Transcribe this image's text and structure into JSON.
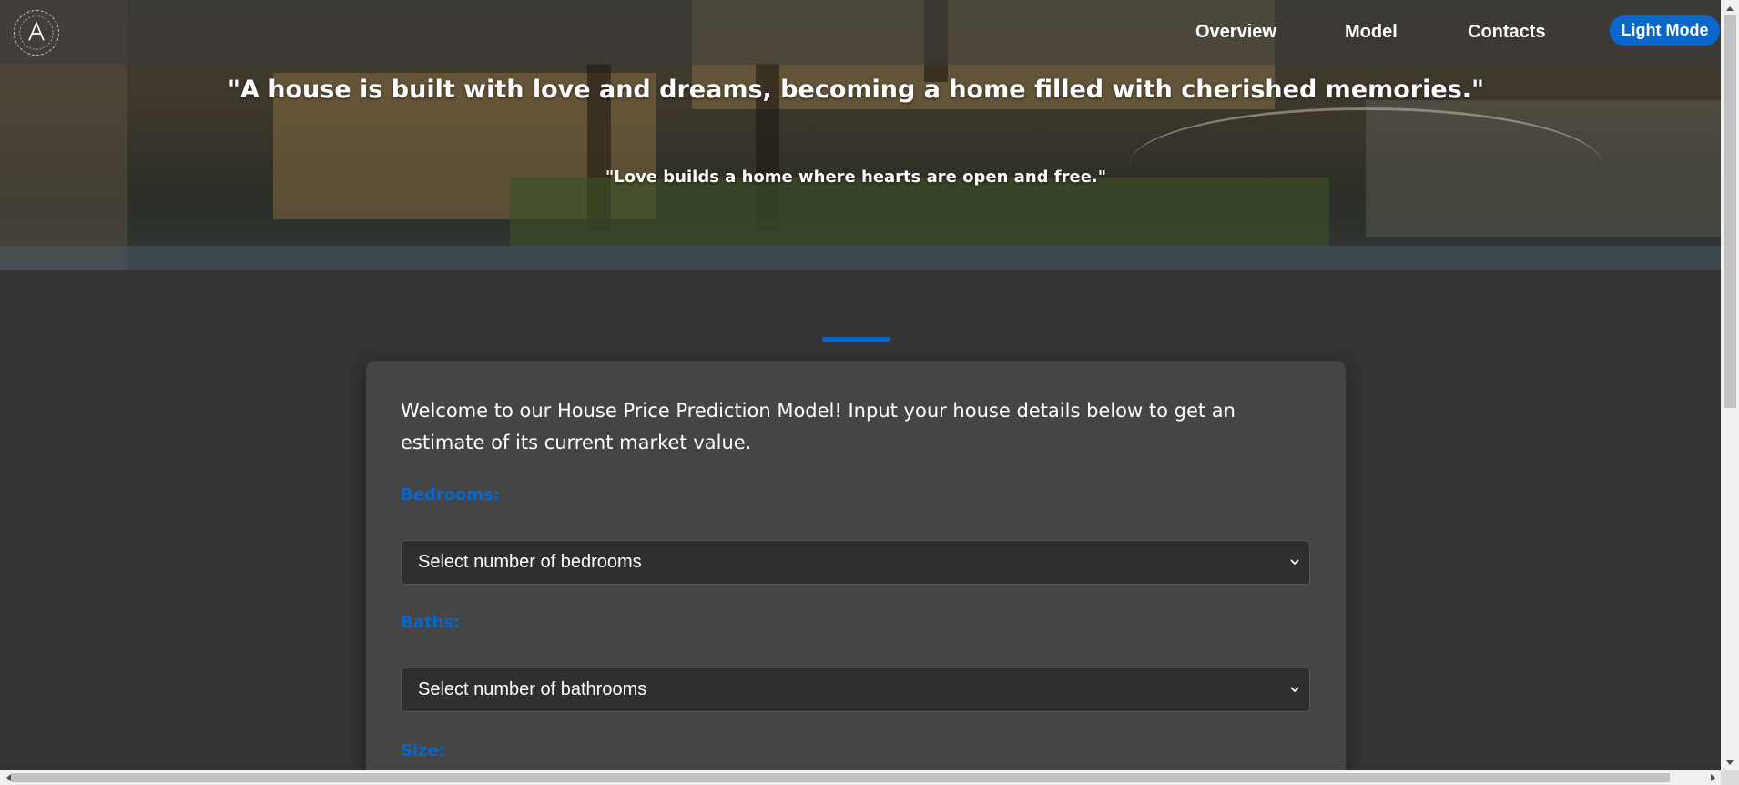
{
  "navbar": {
    "logo_icon": "circular-logo-letter-a-icon",
    "links": [
      {
        "label": "Overview"
      },
      {
        "label": "Model"
      },
      {
        "label": "Contacts"
      }
    ],
    "mode_toggle_label": "Light Mode"
  },
  "hero": {
    "quote_main": "\"A house is built with love and dreams, becoming a home filled with cherished memories.\"",
    "quote_sub": "\"Love builds a home where hearts are open and free.\""
  },
  "form": {
    "intro": "Welcome to our House Price Prediction Model! Input your house details below to get an estimate of its current market value.",
    "bedrooms": {
      "label": "Bedrooms:",
      "selected": "Select number of bedrooms"
    },
    "baths": {
      "label": "Baths:",
      "selected": "Select number of bathrooms"
    },
    "size": {
      "label": "Size:"
    }
  },
  "colors": {
    "accent": "#0a66c9",
    "page_background": "#333333",
    "card_background": "#454545",
    "select_background": "#2f2f2f"
  }
}
